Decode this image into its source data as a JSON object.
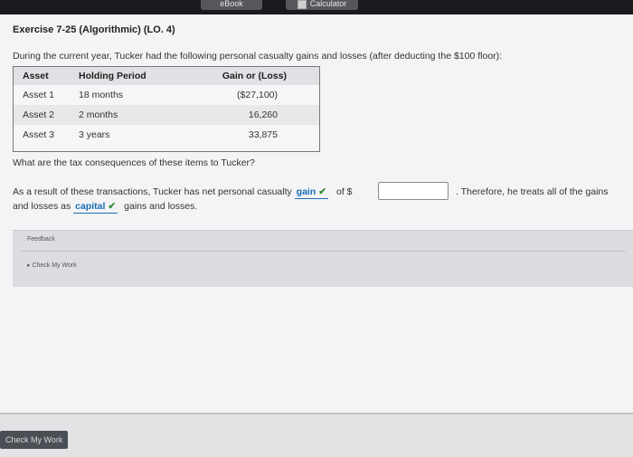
{
  "topbar": {
    "ebook_label": "eBook",
    "calculator_label": "Calculator"
  },
  "exercise": {
    "title": "Exercise 7-25 (Algorithmic) (LO. 4)",
    "intro": "During the current year, Tucker had the following personal casualty gains and losses (after deducting the $100 floor):"
  },
  "table": {
    "headers": [
      "Asset",
      "Holding Period",
      "Gain or (Loss)"
    ],
    "rows": [
      [
        "Asset 1",
        "18 months",
        "($27,100)"
      ],
      [
        "Asset 2",
        "2 months",
        "16,260"
      ],
      [
        "Asset 3",
        "3 years",
        "33,875"
      ]
    ]
  },
  "question": "What are the tax consequences of these items to Tucker?",
  "answer": {
    "prefix": "As a result of these transactions, Tucker has net personal casualty",
    "select1": "gain",
    "of_label": "of $",
    "amount_value": "",
    "suffix": ". Therefore, he treats all of the gains",
    "line2_prefix": "and losses as",
    "select2": "capital",
    "line2_suffix": "gains and losses.",
    "check_mark": "✔"
  },
  "feedback": {
    "label": "Feedback",
    "check_link": "▸ Check My Work"
  },
  "bottom": {
    "check_button": "Check My Work"
  }
}
